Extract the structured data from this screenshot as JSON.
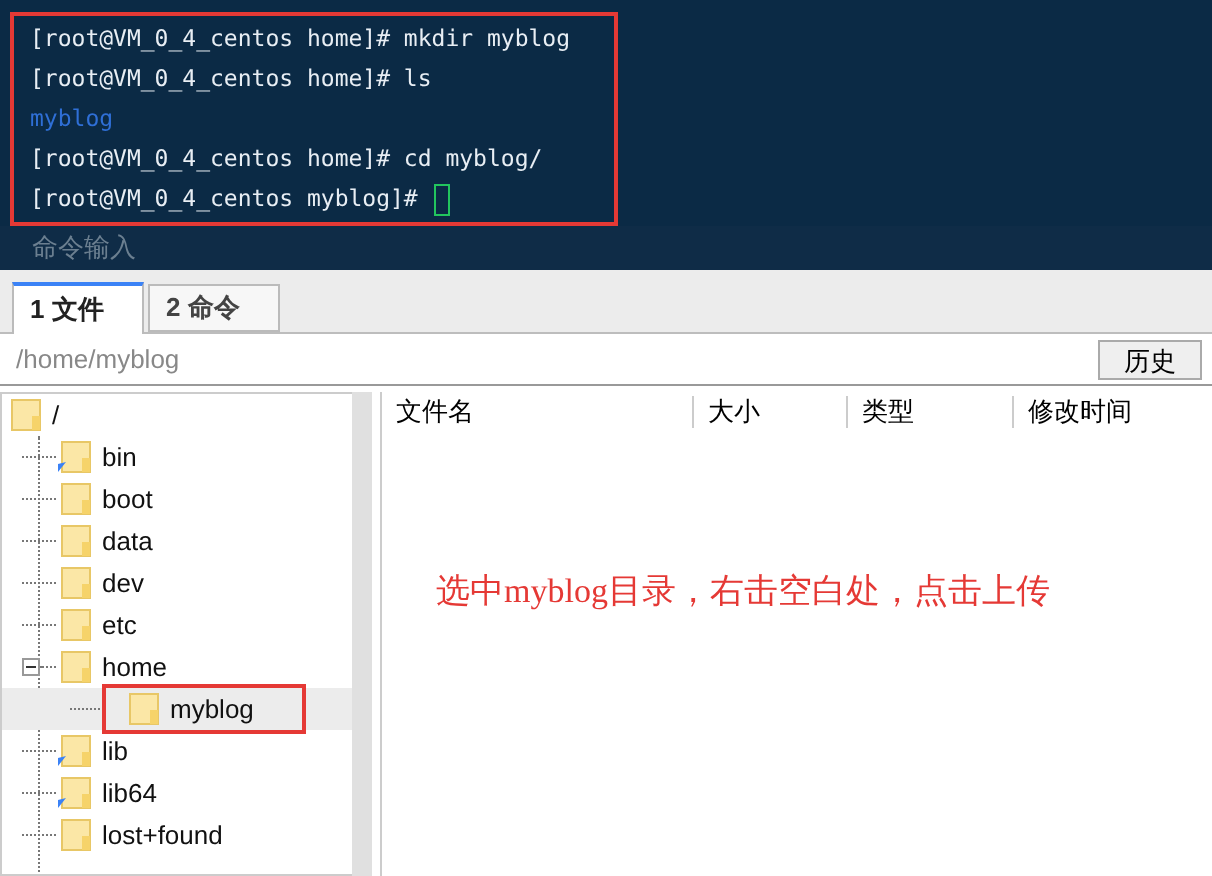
{
  "terminal": {
    "lines": [
      {
        "kind": "prompt",
        "text": "[root@VM_0_4_centos home]# mkdir myblog"
      },
      {
        "kind": "prompt",
        "text": "[root@VM_0_4_centos home]# ls"
      },
      {
        "kind": "output",
        "text": "myblog"
      },
      {
        "kind": "prompt",
        "text": "[root@VM_0_4_centos home]# cd myblog/"
      },
      {
        "kind": "cursor",
        "text": "[root@VM_0_4_centos myblog]#"
      }
    ],
    "command_placeholder": "命令输入"
  },
  "tabs": [
    {
      "label": "1 文件",
      "selected": true
    },
    {
      "label": "2 命令",
      "selected": false
    }
  ],
  "path": "/home/myblog",
  "history_button": "历史",
  "tree": {
    "label": "/",
    "children": [
      {
        "label": "bin",
        "link": true
      },
      {
        "label": "boot",
        "link": false
      },
      {
        "label": "data",
        "link": false
      },
      {
        "label": "dev",
        "link": false
      },
      {
        "label": "etc",
        "link": false
      },
      {
        "label": "home",
        "link": false,
        "expanded": true,
        "children": [
          {
            "label": "myblog",
            "link": false,
            "selected": true
          }
        ]
      },
      {
        "label": "lib",
        "link": true
      },
      {
        "label": "lib64",
        "link": true
      },
      {
        "label": "lost+found",
        "link": false
      }
    ]
  },
  "file_list": {
    "columns": [
      "文件名",
      "大小",
      "类型",
      "修改时间"
    ]
  },
  "annotation": "选中myblog目录，右击空白处，点击上传"
}
